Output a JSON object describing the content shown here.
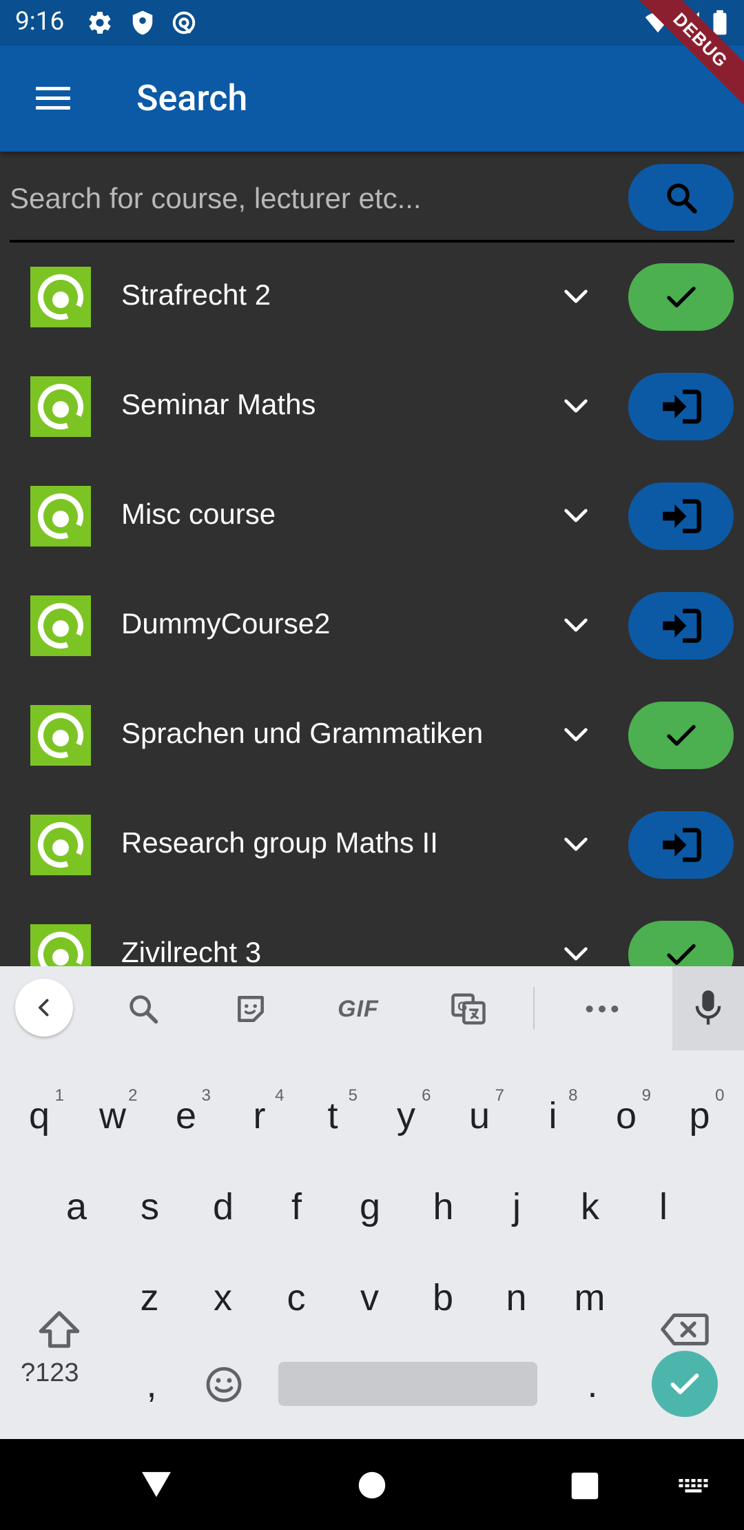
{
  "status_bar": {
    "time": "9:16",
    "debug_label": "DEBUG"
  },
  "app_bar": {
    "title": "Search"
  },
  "search": {
    "placeholder": "Search for course, lecturer etc..."
  },
  "courses": [
    {
      "name": "Strafrecht 2",
      "action": "done"
    },
    {
      "name": "Seminar Maths",
      "action": "enter"
    },
    {
      "name": "Misc course",
      "action": "enter"
    },
    {
      "name": "DummyCourse2",
      "action": "enter"
    },
    {
      "name": "Sprachen und Grammatiken",
      "action": "done"
    },
    {
      "name": "Research group Maths II",
      "action": "enter"
    },
    {
      "name": "Zivilrecht 3",
      "action": "done"
    }
  ],
  "keyboard": {
    "toolbar": {
      "gif_label": "GIF"
    },
    "row1": [
      "q",
      "w",
      "e",
      "r",
      "t",
      "y",
      "u",
      "i",
      "o",
      "p"
    ],
    "row1_hints": [
      "1",
      "2",
      "3",
      "4",
      "5",
      "6",
      "7",
      "8",
      "9",
      "0"
    ],
    "row2": [
      "a",
      "s",
      "d",
      "f",
      "g",
      "h",
      "j",
      "k",
      "l"
    ],
    "row3": [
      "z",
      "x",
      "c",
      "v",
      "b",
      "n",
      "m"
    ],
    "symbols_label": "?123",
    "comma": ",",
    "period": "."
  },
  "colors": {
    "app_bar": "#0c5aa6",
    "done": "#4caf50",
    "enter": "#0c5aa6",
    "logo": "#7cc424"
  }
}
